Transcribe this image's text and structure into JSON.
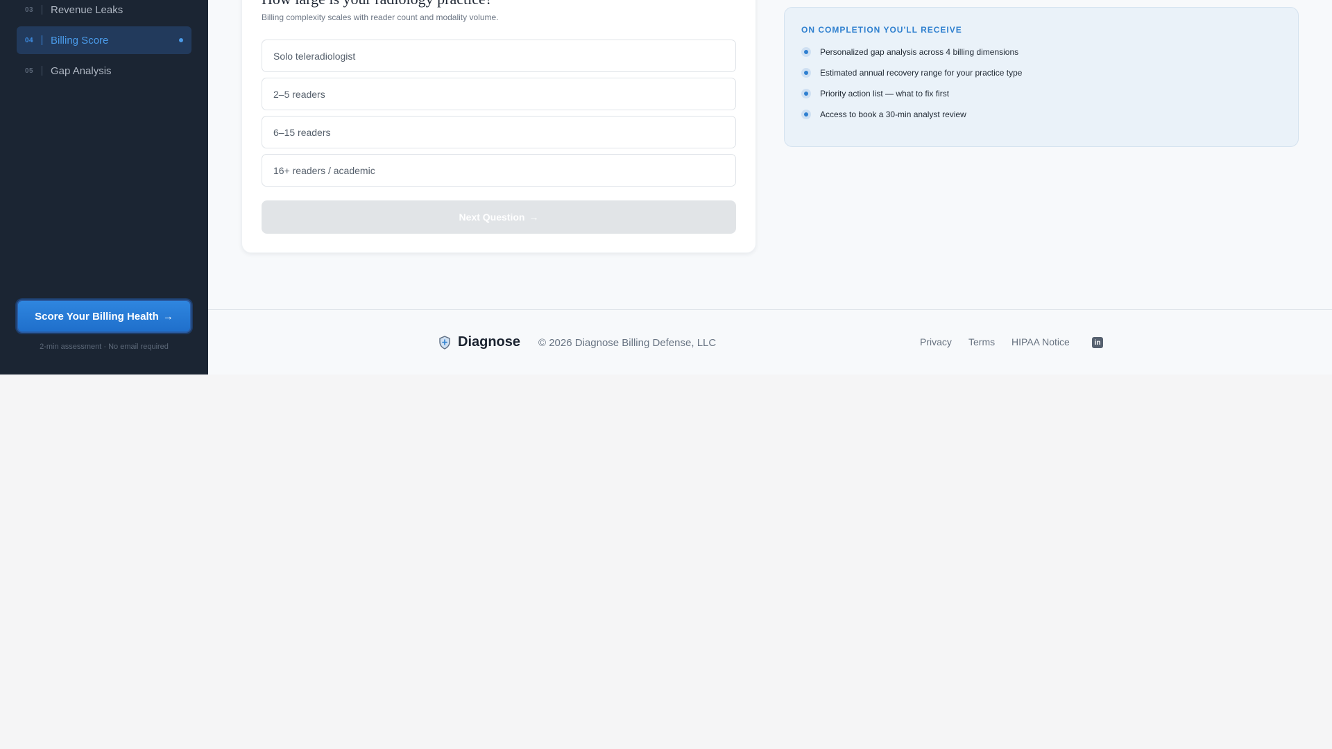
{
  "sidebar": {
    "items": [
      {
        "num": "03",
        "label": "Revenue Leaks",
        "active": false
      },
      {
        "num": "04",
        "label": "Billing Score",
        "active": true
      },
      {
        "num": "05",
        "label": "Gap Analysis",
        "active": false
      }
    ],
    "cta_label": "Score Your Billing Health",
    "cta_arrow": "→",
    "cta_note": "2-min assessment · No email required"
  },
  "question": {
    "title": "How large is your radiology practice?",
    "subtitle": "Billing complexity scales with reader count and modality volume.",
    "options": [
      "Solo teleradiologist",
      "2–5 readers",
      "6–15 readers",
      "16+ readers / academic"
    ],
    "next_label": "Next Question",
    "next_arrow": "→"
  },
  "completion": {
    "title": "ON COMPLETION YOU'LL RECEIVE",
    "items": [
      "Personalized gap analysis across 4 billing dimensions",
      "Estimated annual recovery range for your practice type",
      "Priority action list — what to fix first",
      "Access to book a 30-min analyst review"
    ]
  },
  "footer": {
    "brand": "Diagnose",
    "copyright": "© 2026 Diagnose Billing Defense, LLC",
    "links": [
      "Privacy",
      "Terms",
      "HIPAA Notice"
    ],
    "social_icon": "linkedin-icon",
    "social_glyph": "in"
  },
  "colors": {
    "accent": "#2f80cf",
    "sidebar_bg": "#1b2533"
  }
}
